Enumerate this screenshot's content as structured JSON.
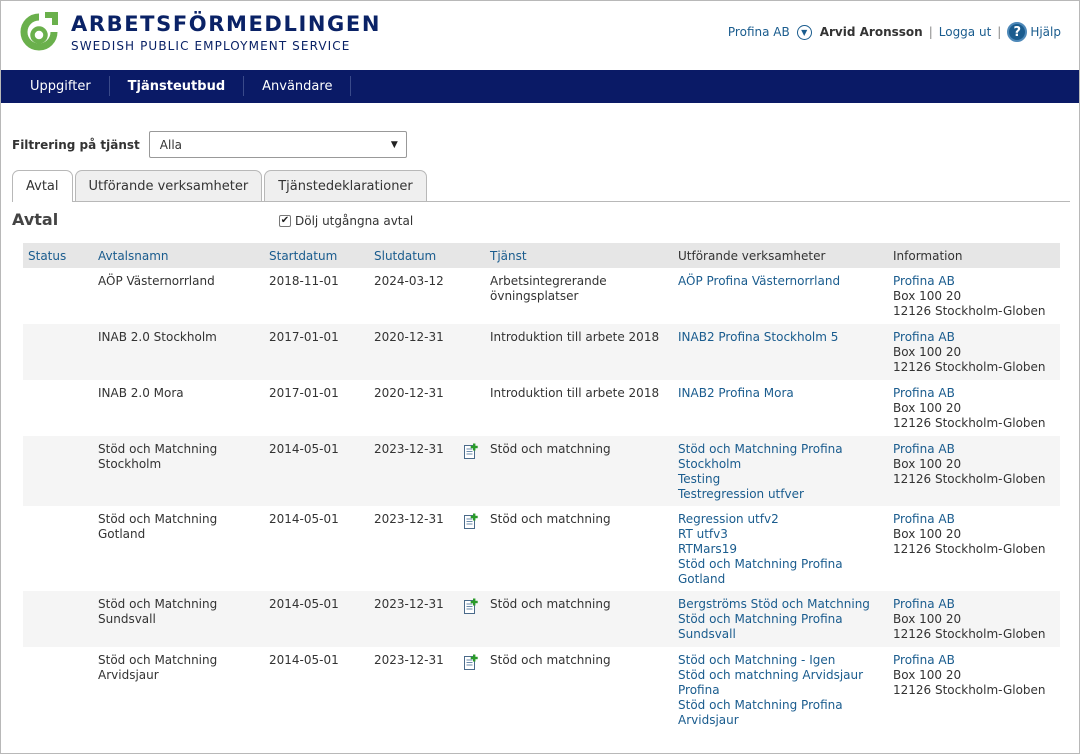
{
  "header": {
    "brand_name": "ARBETSFÖRMEDLINGEN",
    "brand_sub": "SWEDISH PUBLIC EMPLOYMENT SERVICE",
    "org": "Profina AB",
    "user": "Arvid Aronsson",
    "logout": "Logga ut",
    "help": "Hjälp",
    "logo_color": "#6ab04c",
    "brand_color": "#0a2266"
  },
  "nav": {
    "items": [
      "Uppgifter",
      "Tjänsteutbud",
      "Användare"
    ],
    "active": "Tjänsteutbud",
    "bg_color": "#0a1a66"
  },
  "filter": {
    "label": "Filtrering på tjänst",
    "value": "Alla"
  },
  "tabs": [
    "Avtal",
    "Utförande verksamheter",
    "Tjänstedeklarationer"
  ],
  "active_tab": "Avtal",
  "section": {
    "title": "Avtal",
    "hide_expired_label": "Dölj utgångna avtal",
    "hide_expired_checked": true
  },
  "table": {
    "headers": [
      "Status",
      "Avtalsnamn",
      "Startdatum",
      "Slutdatum",
      "Tjänst",
      "Utförande verksamheter",
      "Information"
    ],
    "rows": [
      {
        "status": "",
        "name": [
          "AÖP Västernorrland"
        ],
        "start": "2018-11-01",
        "end": "2024-03-12",
        "has_doc_icon": false,
        "service": [
          "Arbetsintegrerande",
          "övningsplatser"
        ],
        "performers": [
          "AÖP Profina Västernorrland"
        ],
        "info": [
          "Profina AB",
          "Box 100 20",
          "12126 Stockholm-Globen"
        ]
      },
      {
        "status": "",
        "name": [
          "INAB 2.0 Stockholm"
        ],
        "start": "2017-01-01",
        "end": "2020-12-31",
        "has_doc_icon": false,
        "service": [
          "Introduktion till arbete 2018"
        ],
        "performers": [
          "INAB2 Profina Stockholm 5"
        ],
        "info": [
          "Profina AB",
          "Box 100 20",
          "12126 Stockholm-Globen"
        ]
      },
      {
        "status": "",
        "name": [
          "INAB 2.0 Mora"
        ],
        "start": "2017-01-01",
        "end": "2020-12-31",
        "has_doc_icon": false,
        "service": [
          "Introduktion till arbete 2018"
        ],
        "performers": [
          "INAB2 Profina Mora"
        ],
        "info": [
          "Profina AB",
          "Box 100 20",
          "12126 Stockholm-Globen"
        ]
      },
      {
        "status": "",
        "name": [
          "Stöd och Matchning",
          "Stockholm"
        ],
        "start": "2014-05-01",
        "end": "2023-12-31",
        "has_doc_icon": true,
        "service": [
          "Stöd och matchning"
        ],
        "performers": [
          "Stöd och Matchning Profina",
          "Stockholm",
          "Testing",
          "Testregression utfver"
        ],
        "info": [
          "Profina AB",
          "Box 100 20",
          "12126 Stockholm-Globen"
        ]
      },
      {
        "status": "",
        "name": [
          "Stöd och Matchning",
          "Gotland"
        ],
        "start": "2014-05-01",
        "end": "2023-12-31",
        "has_doc_icon": true,
        "service": [
          "Stöd och matchning"
        ],
        "performers": [
          "Regression utfv2",
          "RT utfv3",
          "RTMars19",
          "Stöd och Matchning Profina",
          "Gotland"
        ],
        "info": [
          "Profina AB",
          "Box 100 20",
          "12126 Stockholm-Globen"
        ]
      },
      {
        "status": "",
        "name": [
          "Stöd och Matchning",
          "Sundsvall"
        ],
        "start": "2014-05-01",
        "end": "2023-12-31",
        "has_doc_icon": true,
        "service": [
          "Stöd och matchning"
        ],
        "performers": [
          "Bergströms Stöd och Matchning",
          "Stöd och Matchning Profina",
          "Sundsvall"
        ],
        "info": [
          "Profina AB",
          "Box 100 20",
          "12126 Stockholm-Globen"
        ]
      },
      {
        "status": "",
        "name": [
          "Stöd och Matchning",
          "Arvidsjaur"
        ],
        "start": "2014-05-01",
        "end": "2023-12-31",
        "has_doc_icon": true,
        "service": [
          "Stöd och matchning"
        ],
        "performers": [
          "Stöd och Matchning - Igen",
          "Stöd och matchning Arvidsjaur",
          "Profina",
          "Stöd och Matchning Profina",
          "Arvidsjaur"
        ],
        "info": [
          "Profina AB",
          "Box 100 20",
          "12126 Stockholm-Globen"
        ]
      }
    ]
  }
}
